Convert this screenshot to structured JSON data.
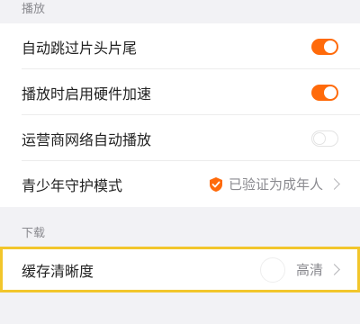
{
  "sections": {
    "playback_header": "播放",
    "download_header": "下载"
  },
  "playback": {
    "skip_intro_outro": {
      "label": "自动跳过片头片尾",
      "state": "on"
    },
    "hardware_accel": {
      "label": "播放时启用硬件加速",
      "state": "on"
    },
    "carrier_autoplay": {
      "label": "运营商网络自动播放",
      "state": "off"
    },
    "youth_mode": {
      "label": "青少年守护模式",
      "value": "已验证为成年人",
      "icon": "shield-check-icon"
    }
  },
  "download": {
    "cache_quality": {
      "label": "缓存清晰度",
      "value": "高清"
    }
  },
  "colors": {
    "accent": "#ff6a0a",
    "highlight_outline": "#f2c62b"
  }
}
